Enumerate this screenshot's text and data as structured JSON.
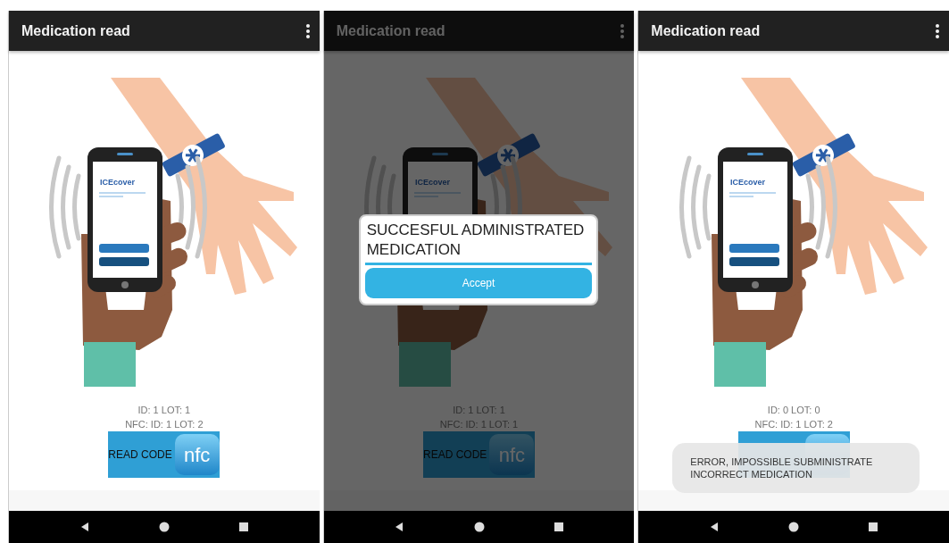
{
  "screens": [
    {
      "title": "Medication read",
      "logo_text": "ICEcover",
      "id_line": "ID: 1 LOT: 1",
      "nfc_line": "NFC: ID: 1 LOT: 2",
      "read_button": "READ CODE",
      "nfc_logo": "nfc"
    },
    {
      "title": "Medication read",
      "logo_text": "ICEcover",
      "id_line": "ID: 1 LOT: 1",
      "nfc_line": "NFC: ID: 1 LOT: 1",
      "read_button": "READ CODE",
      "nfc_logo": "nfc",
      "overlay": {
        "kind": "dialog",
        "message": "SUCCESFUL ADMINISTRATED MEDICATION",
        "button": "Accept"
      }
    },
    {
      "title": "Medication read",
      "logo_text": "ICEcover",
      "id_line": "ID: 0 LOT: 0",
      "nfc_line": "NFC: ID: 1 LOT: 2",
      "overlay": {
        "kind": "toast",
        "message": "ERROR, IMPOSSIBLE SUBMINISTRATE INCORRECT MEDICATION"
      }
    }
  ]
}
